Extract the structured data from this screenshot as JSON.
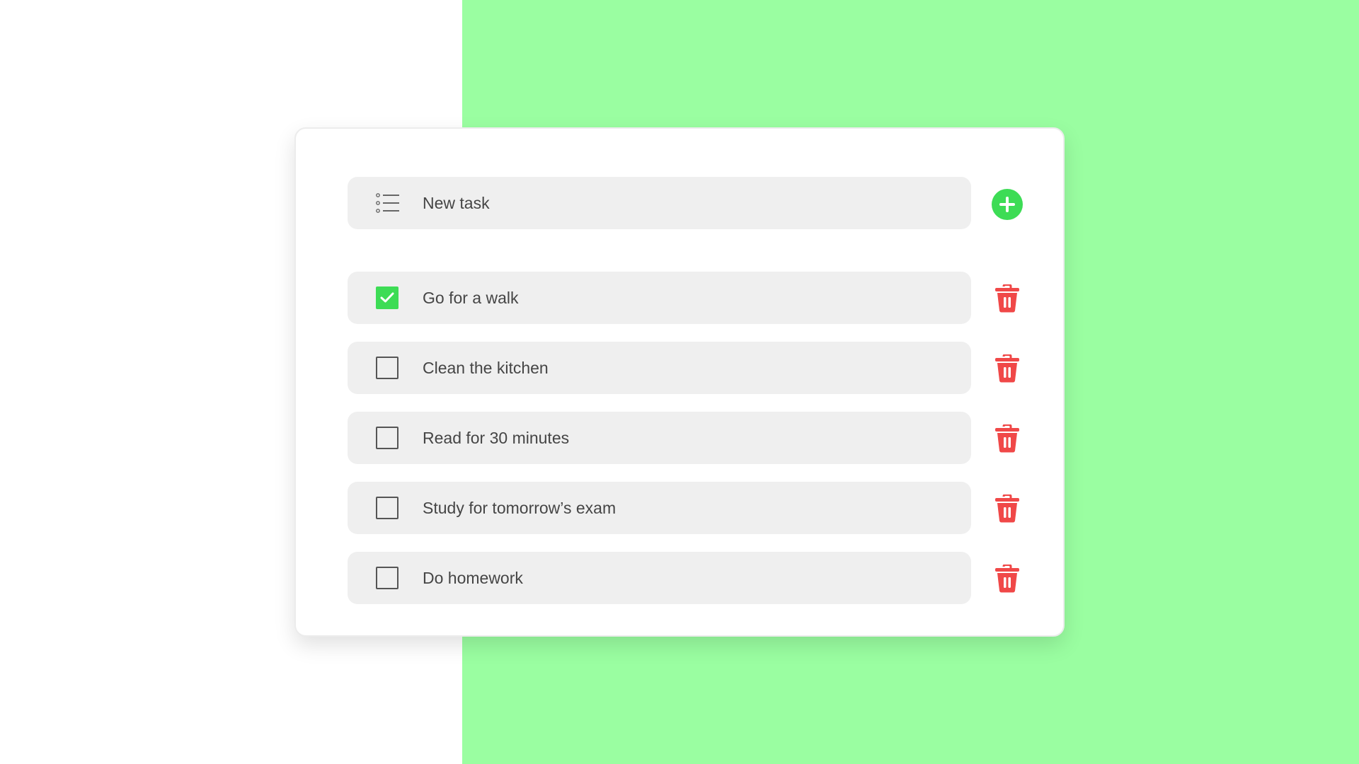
{
  "new_task": {
    "placeholder": "New task",
    "list_icon": "list-icon",
    "add_icon": "plus-icon"
  },
  "tasks": [
    {
      "label": "Go for a walk",
      "done": true
    },
    {
      "label": "Clean the kitchen",
      "done": false
    },
    {
      "label": "Read for 30 minutes",
      "done": false
    },
    {
      "label": "Study for tomorrow’s exam",
      "done": false
    },
    {
      "label": "Do homework",
      "done": false
    }
  ],
  "colors": {
    "accent_green": "#3ddc55",
    "delete_red": "#f04848",
    "background_green": "#9afea1",
    "row_background": "#efefef"
  },
  "icons": {
    "delete": "trash-icon",
    "checked": "checkmark-icon"
  }
}
